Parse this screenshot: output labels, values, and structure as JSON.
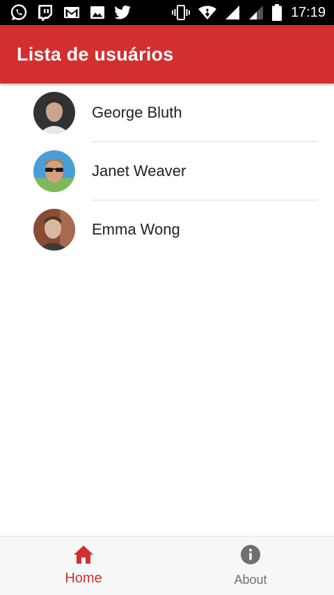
{
  "status_bar": {
    "time": "17:19",
    "left_icons": [
      "whatsapp-icon",
      "twitch-icon",
      "gmail-icon",
      "image-icon",
      "twitter-icon"
    ],
    "right_icons": [
      "vibrate-icon",
      "wifi-icon",
      "signal-icon",
      "signal-weak-icon",
      "battery-icon"
    ]
  },
  "app_bar": {
    "title": "Lista de usuários",
    "color": "#d32f2f"
  },
  "users": [
    {
      "name": "George Bluth"
    },
    {
      "name": "Janet Weaver"
    },
    {
      "name": "Emma Wong"
    }
  ],
  "bottom_nav": {
    "items": [
      {
        "label": "Home",
        "icon": "home-icon",
        "active": true
      },
      {
        "label": "About",
        "icon": "info-icon",
        "active": false
      }
    ],
    "active_color": "#d32f2f",
    "inactive_color": "#707070"
  }
}
